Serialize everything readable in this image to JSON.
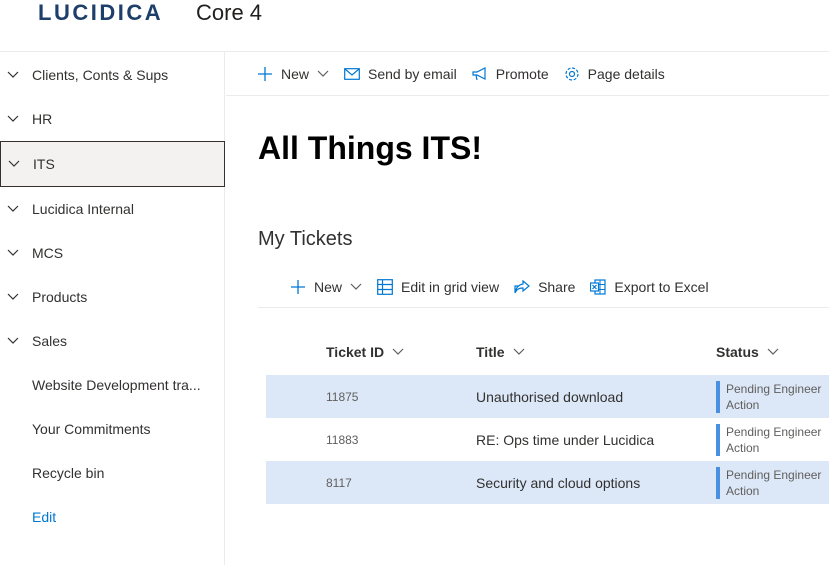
{
  "header": {
    "logo_text": "LUCIDICA",
    "site_title": "Core 4"
  },
  "nav": {
    "items": [
      {
        "label": "Clients, Conts & Sups",
        "expandable": true
      },
      {
        "label": "HR",
        "expandable": true
      },
      {
        "label": "ITS",
        "expandable": true,
        "selected": true
      },
      {
        "label": "Lucidica Internal",
        "expandable": true
      },
      {
        "label": "MCS",
        "expandable": true
      },
      {
        "label": "Products",
        "expandable": true
      },
      {
        "label": "Sales",
        "expandable": true
      },
      {
        "label": "Website Development tra...",
        "expandable": false
      },
      {
        "label": "Your Commitments",
        "expandable": false
      },
      {
        "label": "Recycle bin",
        "expandable": false
      }
    ],
    "edit_label": "Edit"
  },
  "commandbar": {
    "new_label": "New",
    "send_email_label": "Send by email",
    "promote_label": "Promote",
    "page_details_label": "Page details"
  },
  "page": {
    "title": "All Things ITS!",
    "section_title": "My Tickets"
  },
  "list_commandbar": {
    "new_label": "New",
    "edit_grid_label": "Edit in grid view",
    "share_label": "Share",
    "export_label": "Export to Excel"
  },
  "table": {
    "columns": [
      "Ticket ID",
      "Title",
      "Status"
    ],
    "rows": [
      {
        "id": "11875",
        "title": "Unauthorised download",
        "status": "Pending Engineer Action"
      },
      {
        "id": "11883",
        "title": "RE: Ops time under Lucidica",
        "status": "Pending Engineer Action"
      },
      {
        "id": "8117",
        "title": "Security and cloud options",
        "status": "Pending Engineer Action"
      }
    ]
  },
  "colors": {
    "accent": "#0078d4",
    "row_highlight": "#dce8f8",
    "status_bar": "#4a90e2",
    "logo": "#1f3f6b"
  }
}
